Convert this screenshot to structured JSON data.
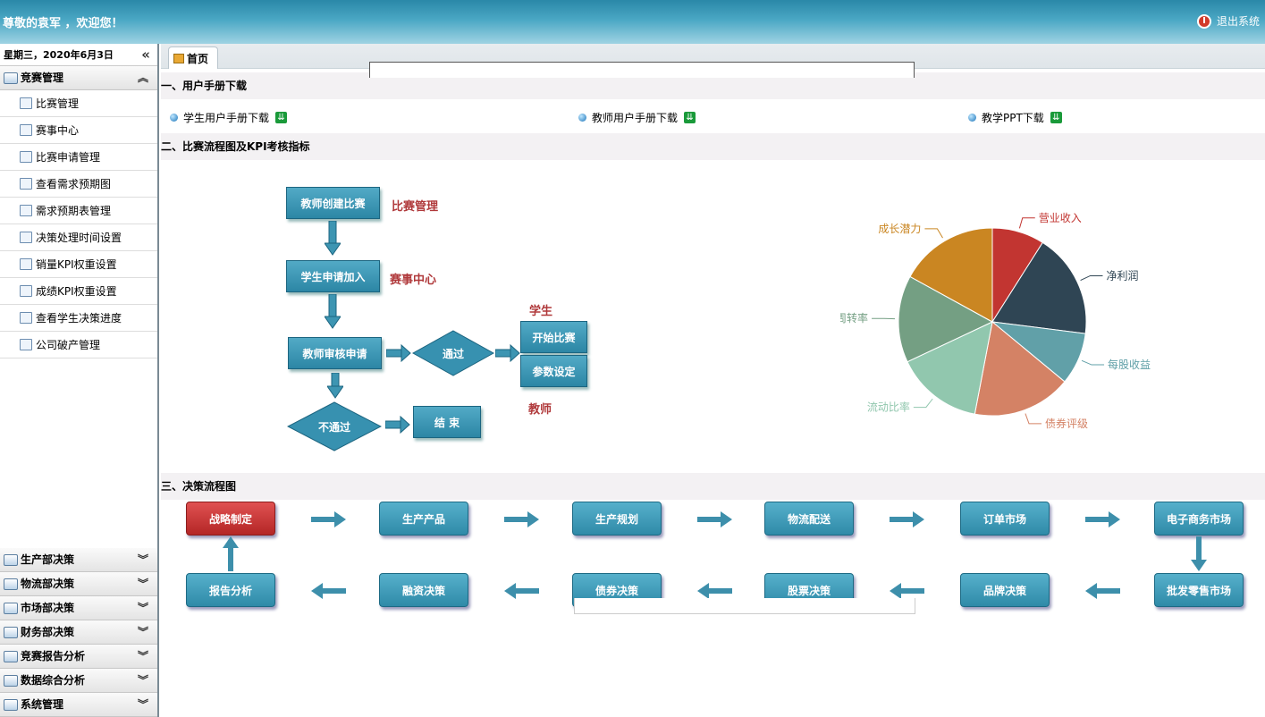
{
  "header": {
    "welcome": "尊敬的袁军 ，欢迎您！",
    "logout": "退出系统"
  },
  "sidebar": {
    "date": "星期三，2020年6月3日",
    "group_open": "竞赛管理",
    "items": [
      {
        "label": "比赛管理"
      },
      {
        "label": "赛事中心"
      },
      {
        "label": "比赛申请管理"
      },
      {
        "label": "查看需求预期图"
      },
      {
        "label": "需求预期表管理"
      },
      {
        "label": "决策处理时间设置"
      },
      {
        "label": "销量KPI权重设置"
      },
      {
        "label": "成绩KPI权重设置"
      },
      {
        "label": "查看学生决策进度"
      },
      {
        "label": "公司破产管理"
      }
    ],
    "groups": [
      {
        "label": "生产部决策"
      },
      {
        "label": "物流部决策"
      },
      {
        "label": "市场部决策"
      },
      {
        "label": "财务部决策"
      },
      {
        "label": "竞赛报告分析"
      },
      {
        "label": "数据综合分析"
      },
      {
        "label": "系统管理"
      }
    ]
  },
  "tab": {
    "home": "首页"
  },
  "sections": {
    "s1": "一、用户手册下载",
    "s2": "二、比赛流程图及KPI考核指标",
    "s3": "三、决策流程图"
  },
  "downloads": [
    {
      "label": "学生用户手册下载"
    },
    {
      "label": "教师用户手册下载"
    },
    {
      "label": "教学PPT下载"
    }
  ],
  "flow": {
    "b1": "教师创建比赛",
    "l1": "比赛管理",
    "b2": "学生申请加入",
    "l2": "赛事中心",
    "b3": "教师审核申请",
    "d1": "通过",
    "b4": "开始比赛",
    "b5": "参数设定",
    "l_student": "学生",
    "l_teacher": "教师",
    "d2": "不通过",
    "b6": "结 束"
  },
  "chart_data": {
    "type": "pie",
    "slices": [
      {
        "name": "营业收入",
        "value": 9,
        "color": "#c23531"
      },
      {
        "name": "净利润",
        "value": 18,
        "color": "#2f4554"
      },
      {
        "name": "每股收益",
        "value": 9,
        "color": "#61a0a8"
      },
      {
        "name": "债券评级",
        "value": 17,
        "color": "#d48265"
      },
      {
        "name": "流动比率",
        "value": 15,
        "color": "#91c7ae"
      },
      {
        "name": "总资产周转率",
        "value": 15,
        "color": "#749f83"
      },
      {
        "name": "成长潜力",
        "value": 17,
        "color": "#ca8622"
      }
    ]
  },
  "decision": {
    "row1": [
      "战略制定",
      "生产产品",
      "生产规划",
      "物流配送",
      "订单市场",
      "电子商务市场"
    ],
    "row2": [
      "报告分析",
      "融资决策",
      "债券决策",
      "股票决策",
      "品牌决策",
      "批发零售市场"
    ]
  }
}
